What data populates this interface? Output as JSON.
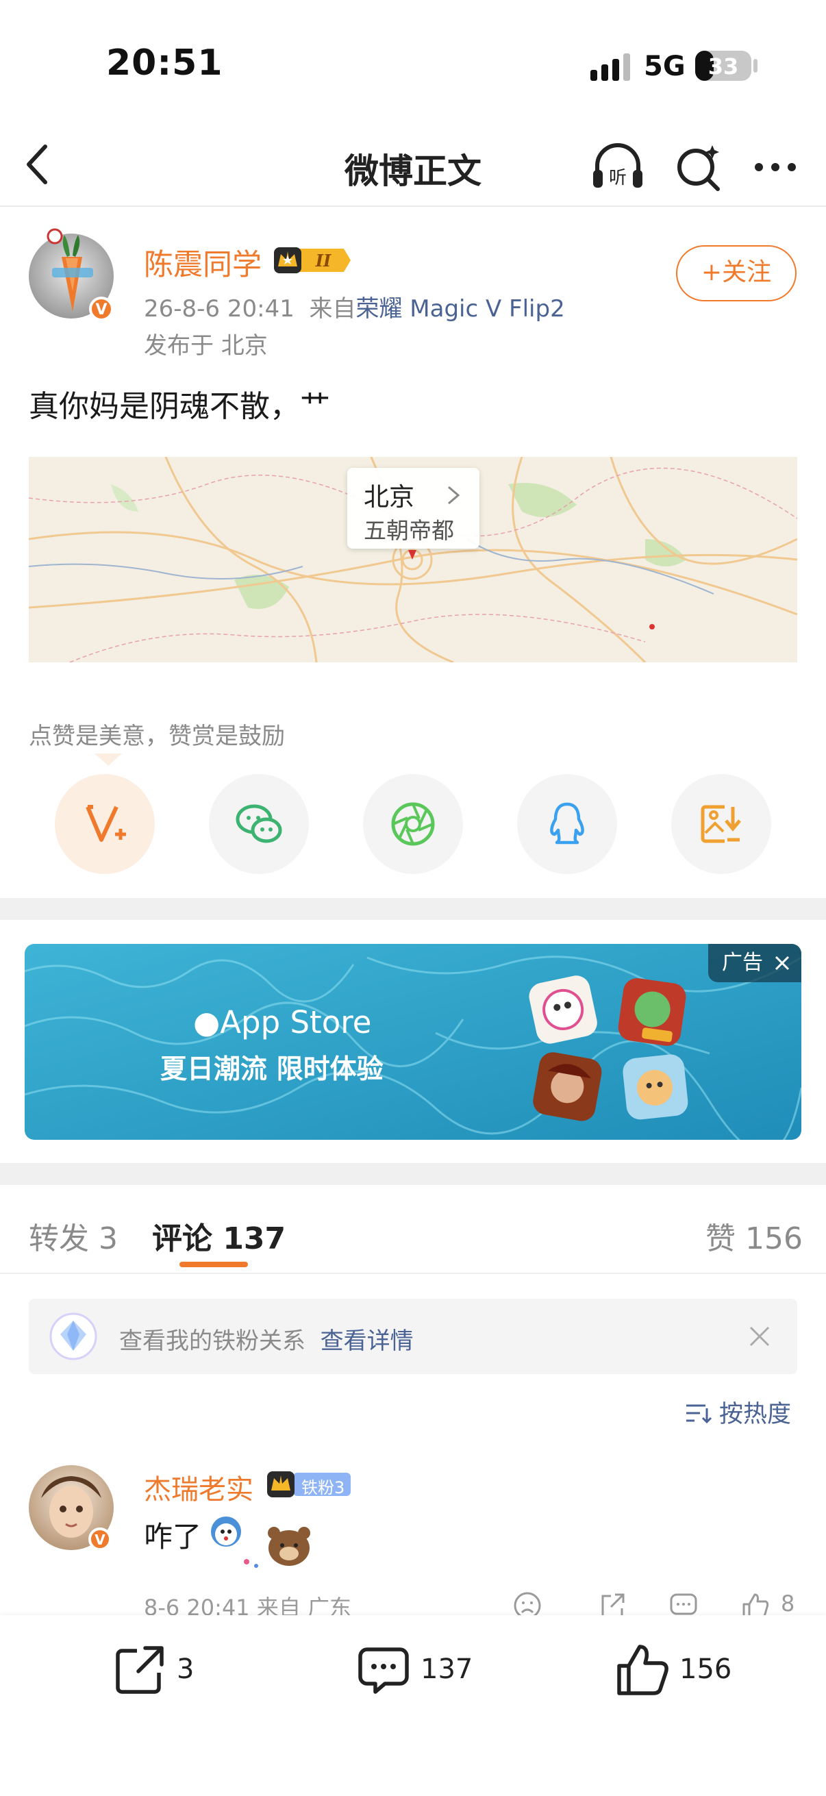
{
  "status_bar": {
    "time": "20:51",
    "network": "5G",
    "battery": "33",
    "battery_fraction": 0.33
  },
  "nav": {
    "title": "微博正文"
  },
  "post": {
    "author": "陈震同学",
    "date": "26-8-6 20:41",
    "source_prefix": "来自",
    "source": "荣耀 Magic V Flip2",
    "location": "发布于 北京",
    "follow_label": "+关注",
    "text": "真你妈是阴魂不散，艹",
    "map_city": "北京",
    "map_subtitle": "五朝帝都"
  },
  "reward": {
    "text": "点赞是美意，赞赏是鼓励",
    "buttons": [
      {
        "name": "reward",
        "icon": "v-plus-icon",
        "color": "#f07a2c"
      },
      {
        "name": "wechat",
        "icon": "wechat-icon",
        "color": "#3cb371"
      },
      {
        "name": "moments",
        "icon": "aperture-icon",
        "color": "#5ac75a"
      },
      {
        "name": "qq",
        "icon": "penguin-icon",
        "color": "#3aa0f0"
      },
      {
        "name": "save-image",
        "icon": "image-download-icon",
        "color": "#f0a030"
      }
    ]
  },
  "ad": {
    "tag": "广告",
    "brand": "App Store",
    "slogan": "夏日潮流 限时体验"
  },
  "tabs": {
    "reposts": "转发 3",
    "comments": "评论 137",
    "likes": "赞 156"
  },
  "fans_bar": {
    "text": "查看我的铁粉关系",
    "link": "查看详情"
  },
  "sort": {
    "label": "按热度"
  },
  "comments": [
    {
      "name": "杰瑞老实",
      "badge": "铁粉3",
      "text": "咋了",
      "meta": "8-6 20:41 来自 广东",
      "likes": "8"
    }
  ],
  "bottom_bar": {
    "reposts": "3",
    "comments": "137",
    "likes": "156"
  },
  "colors": {
    "accent": "#f07a2c",
    "link": "#4a6394",
    "muted": "#8a8a8a"
  }
}
